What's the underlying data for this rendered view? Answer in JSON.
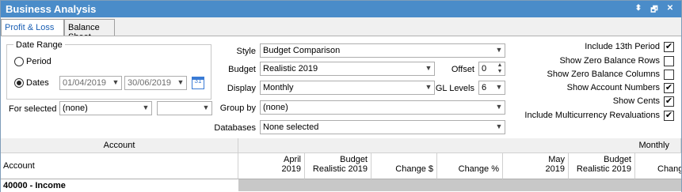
{
  "window": {
    "title": "Business Analysis",
    "pin_glyph": "⬍",
    "restore_glyph": "🗗",
    "close_glyph": "✕"
  },
  "tabs": [
    {
      "label": "Profit & Loss",
      "active": true
    },
    {
      "label": "Balance Sheet",
      "active": false
    }
  ],
  "date_range": {
    "legend": "Date Range",
    "period_label": "Period",
    "dates_label": "Dates",
    "selected": "Dates",
    "from": "01/04/2019",
    "to": "30/06/2019",
    "calendar_glyph": "31"
  },
  "for_selected": {
    "label": "For selected",
    "value1": "(none)",
    "value2": ""
  },
  "style": {
    "label": "Style",
    "value": "Budget Comparison"
  },
  "budget": {
    "label": "Budget",
    "value": "Realistic 2019"
  },
  "display": {
    "label": "Display",
    "value": "Monthly"
  },
  "group_by": {
    "label": "Group by",
    "value": "(none)"
  },
  "databases": {
    "label": "Databases",
    "value": "None selected"
  },
  "offset": {
    "label": "Offset",
    "value": "0"
  },
  "gl_levels": {
    "label": "GL Levels",
    "value": "6"
  },
  "options": [
    {
      "label": "Include 13th Period",
      "checked": true
    },
    {
      "label": "Show Zero Balance Rows",
      "checked": false
    },
    {
      "label": "Show Zero Balance Columns",
      "checked": false
    },
    {
      "label": "Show Account Numbers",
      "checked": true
    },
    {
      "label": "Show Cents",
      "checked": true
    },
    {
      "label": "Include Multicurrency Revaluations",
      "checked": true
    }
  ],
  "grid": {
    "group_headers": {
      "account": "Account",
      "monthly": "Monthly"
    },
    "columns": {
      "account": "Account",
      "april_l1": "April",
      "april_l2": "2019",
      "budget1_l1": "Budget",
      "budget1_l2": "Realistic 2019",
      "change_dollar": "Change $",
      "change_pct": "Change %",
      "may_l1": "May",
      "may_l2": "2019",
      "budget2_l1": "Budget",
      "budget2_l2": "Realistic 2019",
      "change_dollar2": "Chang"
    },
    "rows": [
      {
        "account": "40000 - Income"
      }
    ]
  },
  "glyphs": {
    "dropdown": "▼",
    "check": "✔",
    "spin_up": "▲",
    "spin_down": "▼"
  }
}
